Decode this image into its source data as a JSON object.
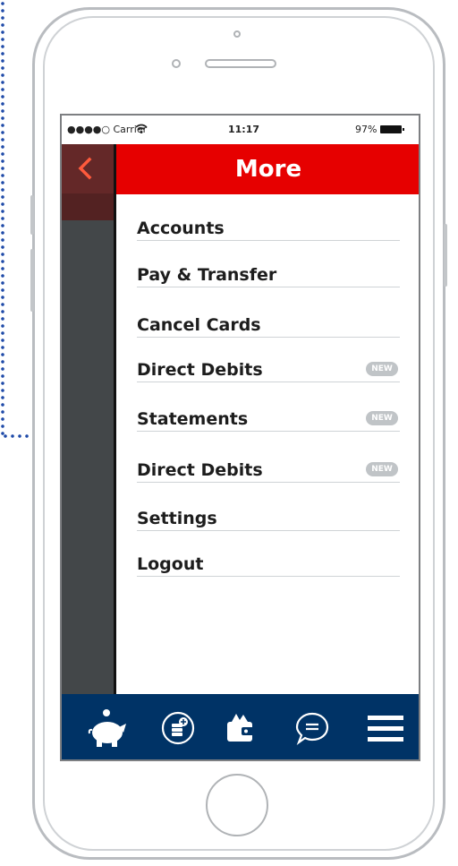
{
  "status_bar": {
    "carrier": "●●●●○ Carrier",
    "time": "11:17",
    "battery": "97%"
  },
  "header": {
    "title": "More"
  },
  "menu": {
    "items": [
      {
        "label": "Accounts",
        "badge": ""
      },
      {
        "label": "Pay & Transfer",
        "badge": ""
      },
      {
        "label": "Cancel Cards",
        "badge": ""
      },
      {
        "label": "Direct Debits",
        "badge": "NEW"
      },
      {
        "label": "Statements",
        "badge": "NEW"
      },
      {
        "label": "Direct Debits",
        "badge": "NEW"
      },
      {
        "label": "Settings",
        "badge": ""
      },
      {
        "label": "Logout",
        "badge": ""
      }
    ]
  },
  "tab_bar": {
    "icons": [
      "piggy-bank-icon",
      "coins-icon",
      "wallet-icon",
      "chat-bubble-icon",
      "hamburger-menu-icon"
    ]
  },
  "colors": {
    "header_red": "#e60000",
    "tabbar_navy": "#003366",
    "panel_dark": "#434749",
    "badge_grey": "#c0c4c7",
    "connector_blue": "#1f4aa8"
  }
}
